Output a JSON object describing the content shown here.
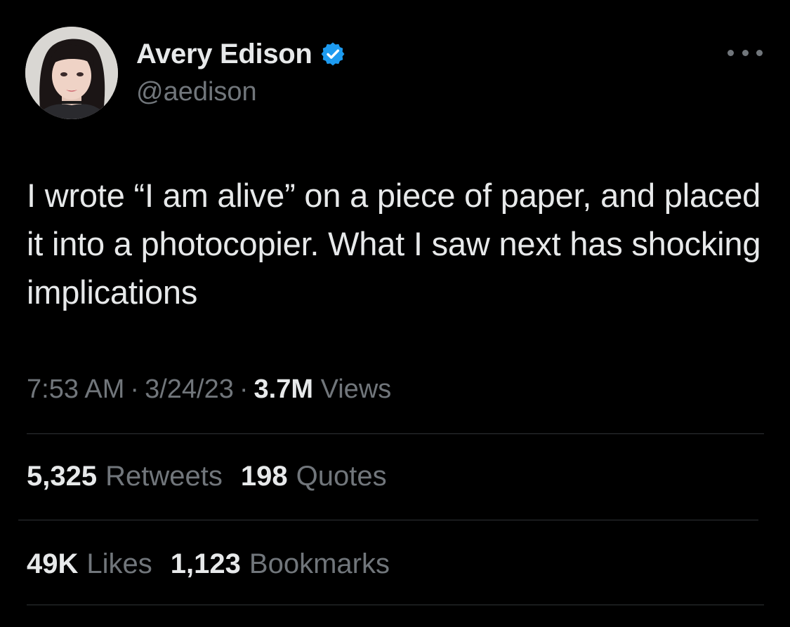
{
  "author": {
    "name": "Avery Edison",
    "handle": "@aedison",
    "verified": true,
    "verified_color": "#1d9bf0"
  },
  "tweet": {
    "text": "I wrote “I am alive” on a piece of paper, and placed it into a photocopier. What I saw next has shocking implications",
    "time": "7:53 AM",
    "date": "3/24/23",
    "views_count": "3.7M",
    "views_label": "Views",
    "separator": "·"
  },
  "stats": {
    "retweets_count": "5,325",
    "retweets_label": "Retweets",
    "quotes_count": "198",
    "quotes_label": "Quotes",
    "likes_count": "49K",
    "likes_label": "Likes",
    "bookmarks_count": "1,123",
    "bookmarks_label": "Bookmarks"
  },
  "icons": {
    "more": "more-dots-icon",
    "verified": "verified-badge-icon"
  },
  "colors": {
    "background": "#000000",
    "primary_text": "#e7e9ea",
    "secondary_text": "#71767b",
    "divider": "#2f3336"
  }
}
